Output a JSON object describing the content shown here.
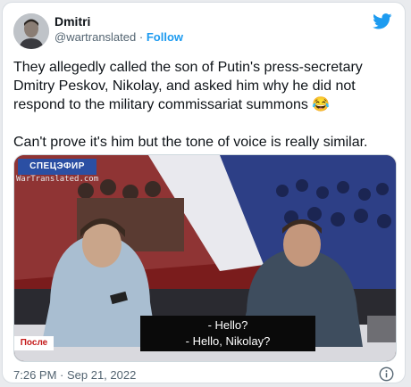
{
  "tweet": {
    "author_name": "Dmitri",
    "author_handle": "@wartranslated",
    "separator": "·",
    "follow_label": "Follow",
    "text": "They allegedly called the son of Putin's press-secretary Dmitry Peskov, Nikolay, and asked him why he did not respond to the military commissariat summons 😂\n\nCan't prove it's him but the tone of voice is really similar.",
    "timestamp": "7:26 PM · Sep 21, 2022"
  },
  "media": {
    "channel_logo": "СПЕЦЭФИР",
    "watermark": "WarTranslated.com",
    "corner_tag": "После",
    "subtitle_line1": "- Hello?",
    "subtitle_line2": "- Hello, Nikolay?"
  },
  "icons": {
    "brand": "twitter-bird-icon",
    "info": "info-icon"
  },
  "colors": {
    "accent": "#1d9bf0",
    "text": "#0f1419",
    "secondary": "#536471"
  }
}
